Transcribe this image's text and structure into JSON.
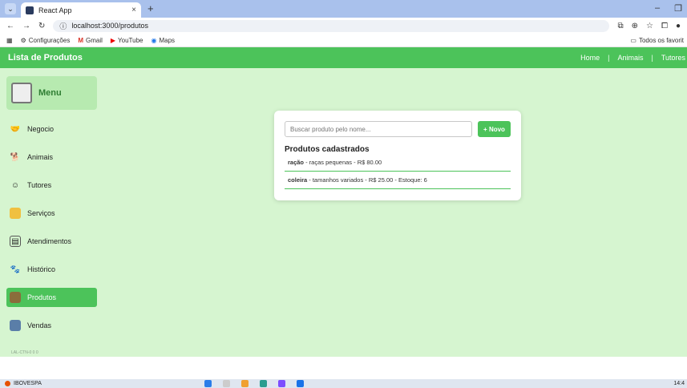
{
  "browser": {
    "tab_title": "React App",
    "tab_close": "×",
    "new_tab": "+",
    "url": "localhost:3000/produtos",
    "win_min": "–",
    "win_max": "❐",
    "bookmarks": [
      {
        "label": "Configurações",
        "icon": "gear-icon"
      },
      {
        "label": "Gmail",
        "icon": "gmail-icon"
      },
      {
        "label": "YouTube",
        "icon": "youtube-icon"
      },
      {
        "label": "Maps",
        "icon": "maps-icon"
      }
    ],
    "all_bookmarks": "Todos os favorit"
  },
  "app": {
    "title": "Lista de Produtos",
    "nav": [
      "Home",
      "Animais",
      "Tutores"
    ],
    "nav_sep": "|",
    "accent": "#4cc35a",
    "background": "#d6f5d0"
  },
  "sidebar": {
    "header": "Menu",
    "items": [
      {
        "label": "Negocio",
        "icon": "business-icon"
      },
      {
        "label": "Animais",
        "icon": "animal-icon"
      },
      {
        "label": "Tutores",
        "icon": "person-icon"
      },
      {
        "label": "Serviços",
        "icon": "service-icon"
      },
      {
        "label": "Atendimentos",
        "icon": "clipboard-icon"
      },
      {
        "label": "Histórico",
        "icon": "history-icon"
      },
      {
        "label": "Produtos",
        "icon": "store-icon",
        "active": true
      },
      {
        "label": "Vendas",
        "icon": "sales-icon"
      }
    ],
    "footer": "LAL-CTN-0 0 0"
  },
  "main": {
    "search_placeholder": "Buscar produto pelo nome...",
    "new_button": "+ Novo",
    "list_title": "Produtos cadastrados",
    "products": [
      {
        "name": "ração",
        "details": " - raças pequenas - R$ 80.00"
      },
      {
        "name": "coleira",
        "details": " - tamanhos variados - R$ 25.00 - Estoque: 6"
      }
    ]
  },
  "taskbar": {
    "ticker": "IBOVESPA",
    "clock": "14:4"
  }
}
